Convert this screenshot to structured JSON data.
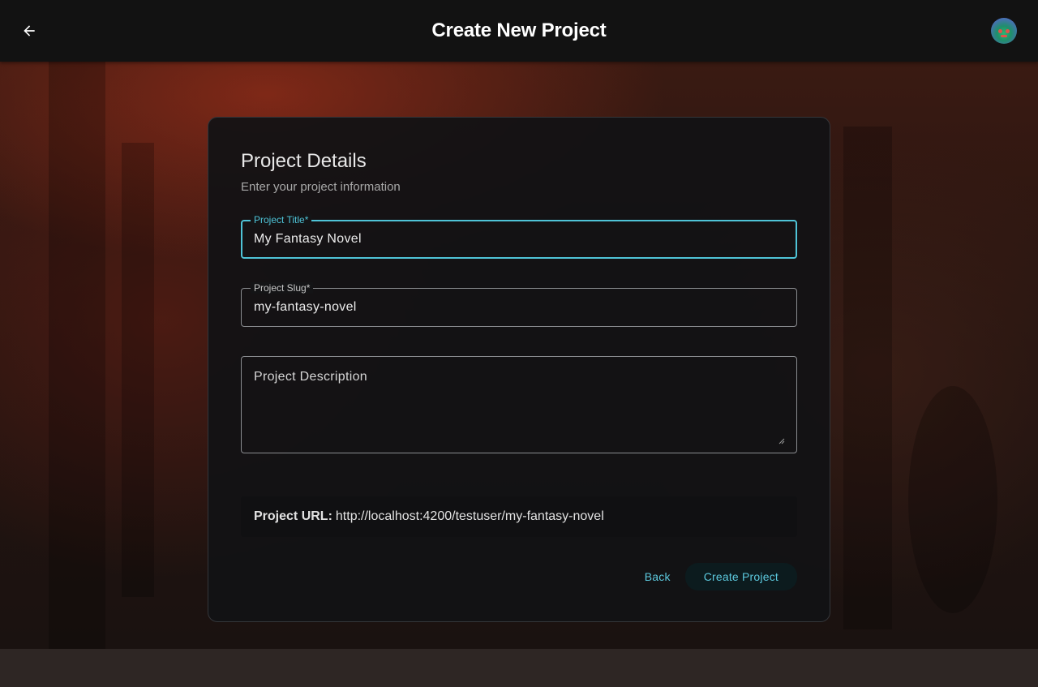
{
  "header": {
    "title": "Create New Project",
    "back_icon": "arrow-left-icon",
    "avatar_icon": "user-avatar"
  },
  "card": {
    "title": "Project Details",
    "subtitle": "Enter your project information"
  },
  "form": {
    "title_field": {
      "label": "Project Title*",
      "value": "My Fantasy Novel",
      "focused": true
    },
    "slug_field": {
      "label": "Project Slug*",
      "value": "my-fantasy-novel"
    },
    "description_field": {
      "placeholder": "Project Description",
      "value": ""
    }
  },
  "url_preview": {
    "label": "Project URL:",
    "value": "http://localhost:4200/testuser/my-fantasy-novel"
  },
  "actions": {
    "back_label": "Back",
    "create_label": "Create Project"
  },
  "colors": {
    "accent": "#4fc3d7",
    "topbar": "#121212",
    "card_bg": "#141416"
  }
}
